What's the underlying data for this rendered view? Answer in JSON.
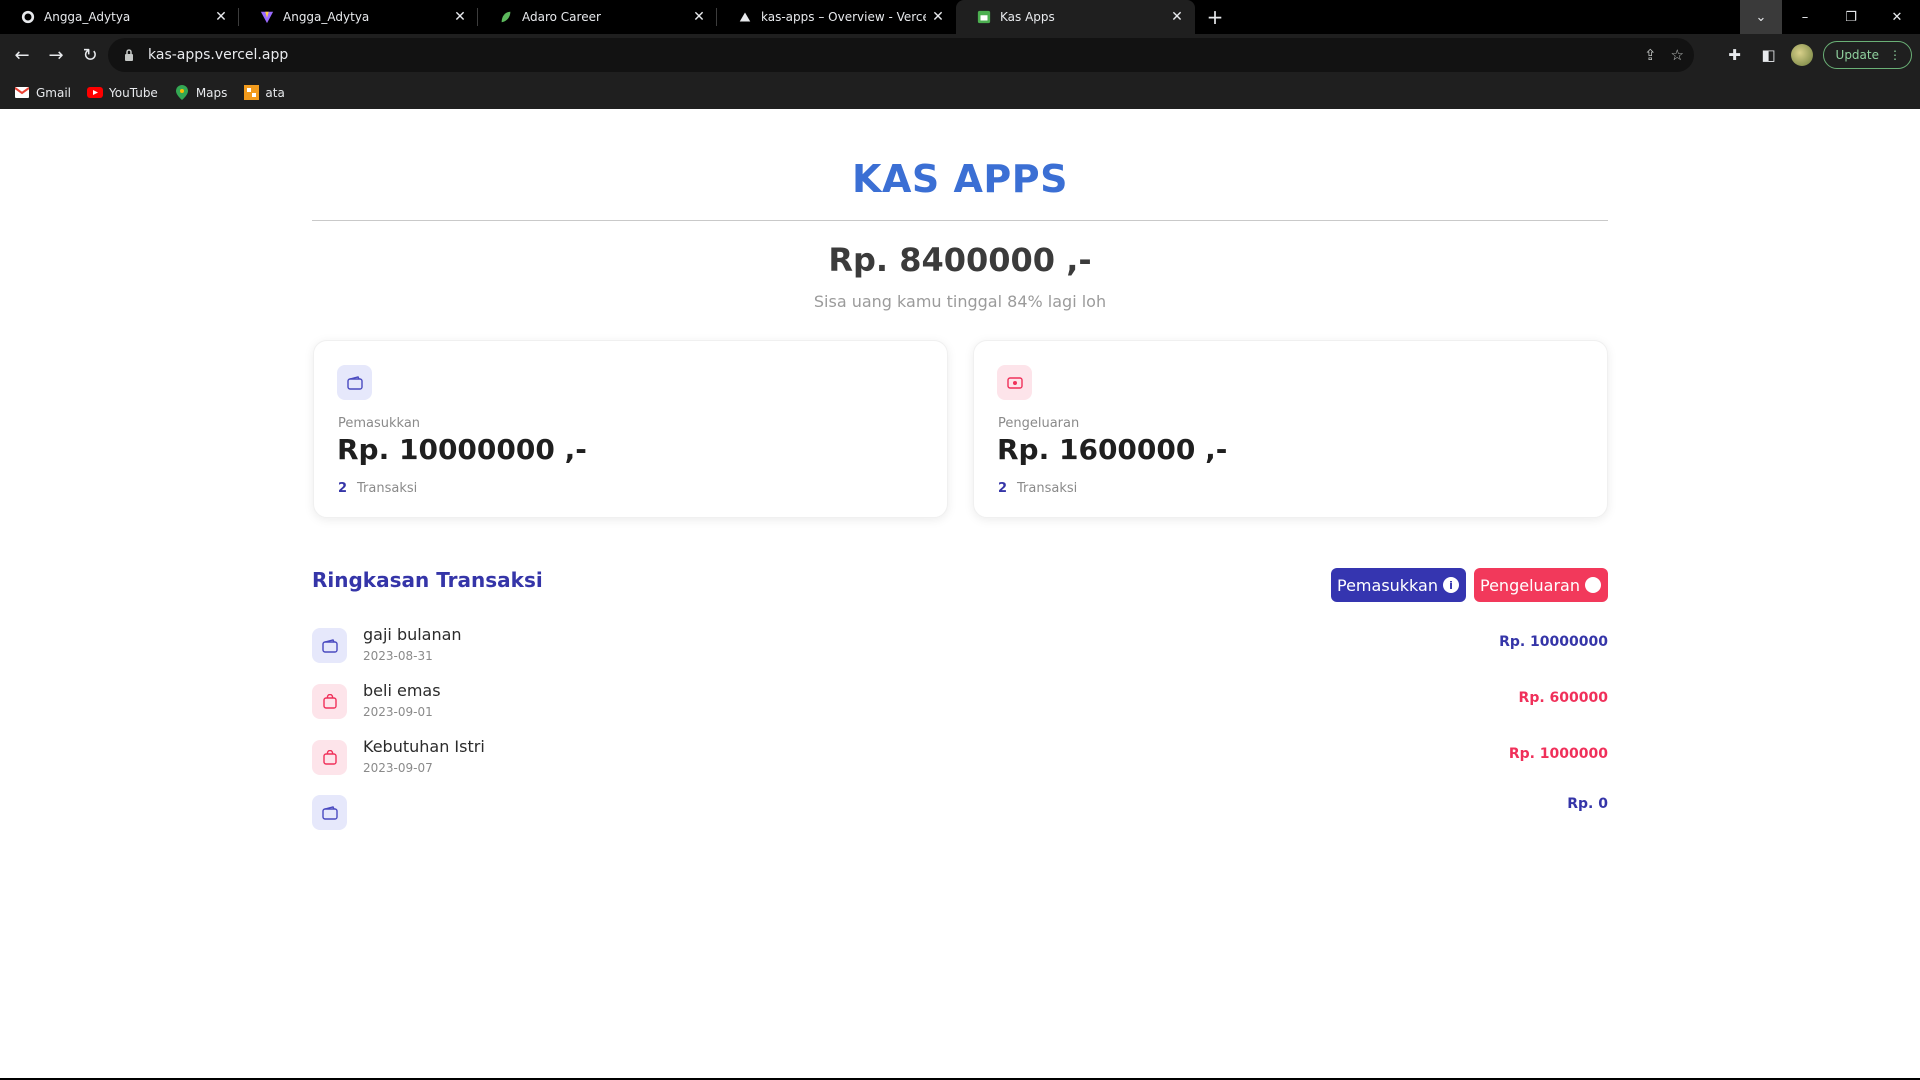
{
  "browser": {
    "tabs": [
      {
        "title": "Angga_Adytya",
        "icon": "github-icon",
        "active": false
      },
      {
        "title": "Angga_Adytya",
        "icon": "vite-icon",
        "active": false
      },
      {
        "title": "Adaro Career",
        "icon": "adaro-icon",
        "active": false
      },
      {
        "title": "kas-apps – Overview - Vercel",
        "icon": "vercel-icon",
        "active": false
      },
      {
        "title": "Kas Apps",
        "icon": "kas-apps-icon",
        "active": true
      }
    ],
    "url": "kas-apps.vercel.app",
    "update_label": "Update",
    "bookmarks": [
      {
        "label": "Gmail",
        "icon": "gmail-icon"
      },
      {
        "label": "YouTube",
        "icon": "youtube-icon"
      },
      {
        "label": "Maps",
        "icon": "maps-icon"
      },
      {
        "label": "ata",
        "icon": "ata-icon"
      }
    ]
  },
  "app": {
    "title": "KAS APPS",
    "balance": "Rp. 8400000 ,-",
    "subtitle": "Sisa uang kamu tinggal 84% lagi loh",
    "income_card": {
      "label": "Pemasukkan",
      "amount": "Rp. 10000000 ,-",
      "count": "2",
      "count_label": "Transaksi"
    },
    "expense_card": {
      "label": "Pengeluaran",
      "amount": "Rp. 1600000 ,-",
      "count": "2",
      "count_label": "Transaksi"
    },
    "summary_title": "Ringkasan Transaksi",
    "buttons": {
      "income": "Pemasukkan",
      "income_badge": "i",
      "expense": "Pengeluaran"
    },
    "transactions": [
      {
        "name": "gaji bulanan",
        "date": "2023-08-31",
        "amount": "Rp. 10000000",
        "type": "income"
      },
      {
        "name": "beli emas",
        "date": "2023-09-01",
        "amount": "Rp. 600000",
        "type": "expense"
      },
      {
        "name": "Kebutuhan Istri",
        "date": "2023-09-07",
        "amount": "Rp. 1000000",
        "type": "expense"
      },
      {
        "name": "",
        "date": "",
        "amount": "Rp. 0",
        "type": "income"
      }
    ],
    "colors": {
      "title": "#3b6fd4",
      "primary": "#3535b0",
      "danger": "#f2395b"
    }
  }
}
